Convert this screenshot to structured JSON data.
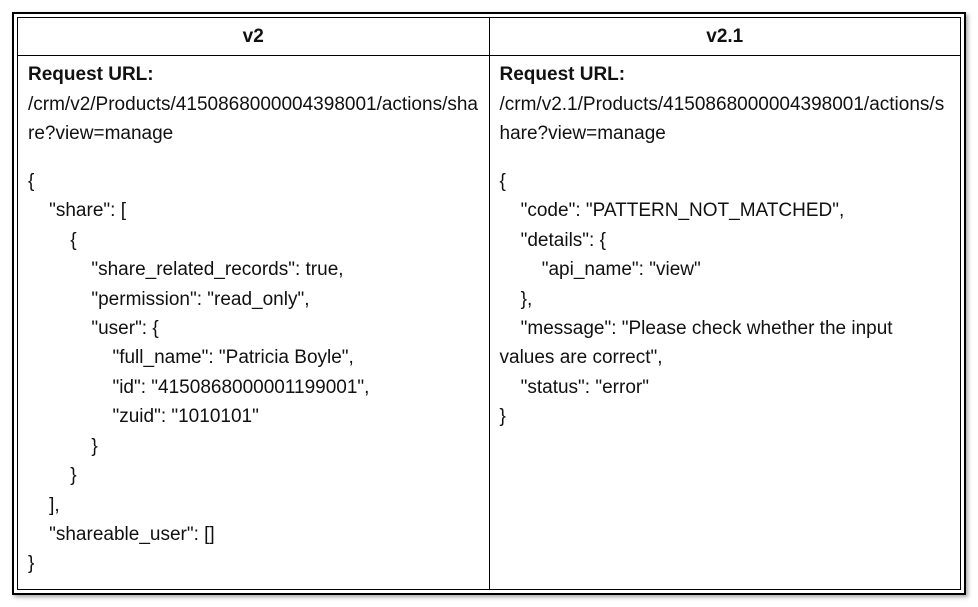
{
  "columns": {
    "left": {
      "header": "v2",
      "request_label": "Request URL:",
      "request_url": "/crm/v2/Products/4150868000004398001/actions/share?view=manage",
      "body": "{\n    \"share\": [\n        {\n            \"share_related_records\": true,\n            \"permission\": \"read_only\",\n            \"user\": {\n                \"full_name\": \"Patricia Boyle\",\n                \"id\": \"4150868000001199001\",\n                \"zuid\": \"1010101\"\n            }\n        }\n    ],\n    \"shareable_user\": []\n}"
    },
    "right": {
      "header": "v2.1",
      "request_label": "Request URL:",
      "request_url": "/crm/v2.1/Products/4150868000004398001/actions/share?view=manage",
      "body": "{\n    \"code\": \"PATTERN_NOT_MATCHED\",\n    \"details\": {\n        \"api_name\": \"view\"\n    },\n    \"message\": \"Please check whether the input values are correct\",\n    \"status\": \"error\"\n}"
    }
  }
}
